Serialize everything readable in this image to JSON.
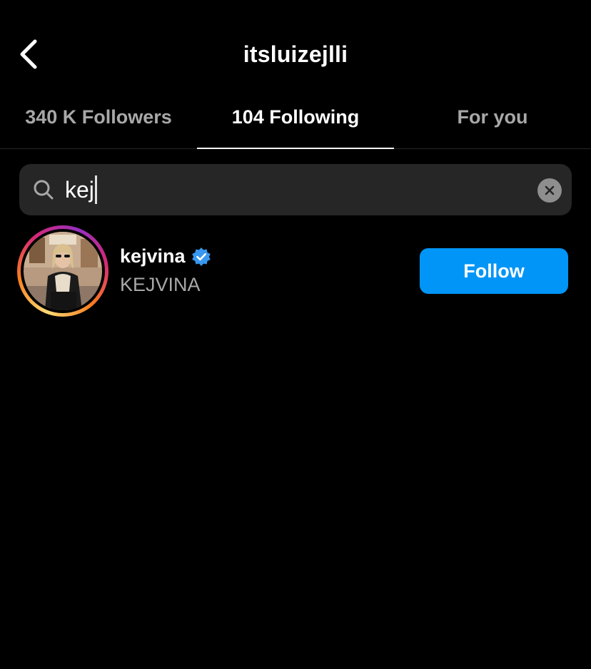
{
  "header": {
    "title": "itsluizejlli",
    "back_icon": "chevron-left-icon"
  },
  "tabs": [
    {
      "label": "340 K Followers",
      "active": false
    },
    {
      "label": "104 Following",
      "active": true
    },
    {
      "label": "For you",
      "active": false
    }
  ],
  "search": {
    "value": "kej",
    "icon": "search-icon",
    "clear_icon": "clear-icon"
  },
  "results": [
    {
      "username": "kejvina",
      "verified": true,
      "full_name": "KEJVINA",
      "follow_label": "Follow",
      "has_story_ring": true
    }
  ],
  "colors": {
    "background": "#000000",
    "primary_text": "#ffffff",
    "secondary_text": "#a8a8a8",
    "search_bg": "#262626",
    "follow_button": "#0095f6",
    "verified_badge": "#3897f0"
  }
}
